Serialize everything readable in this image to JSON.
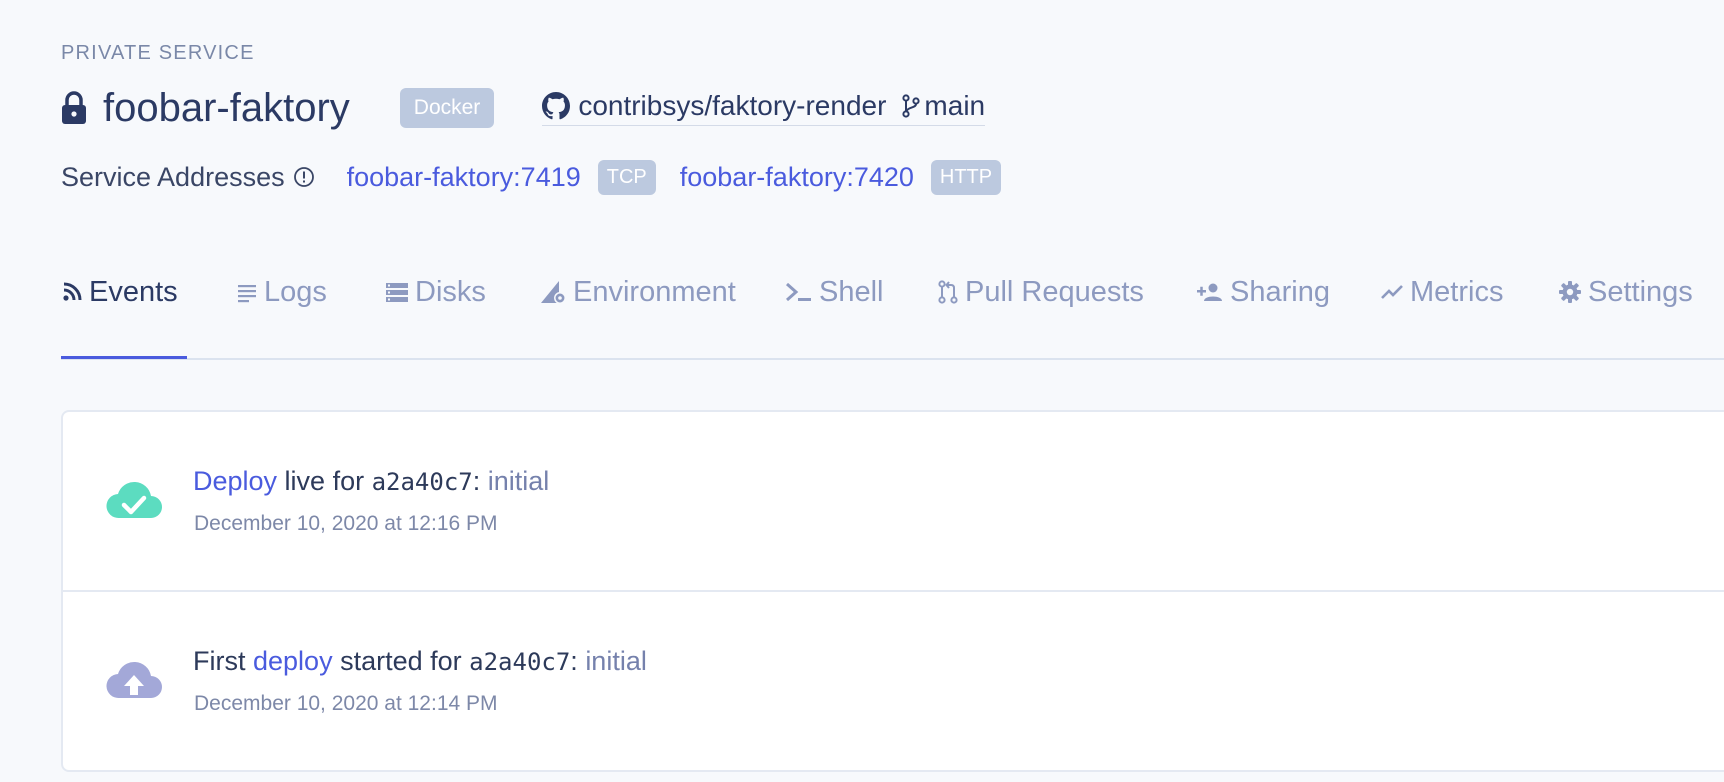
{
  "header": {
    "eyebrow": "PRIVATE SERVICE",
    "title": "foobar-faktory",
    "runtime_badge": "Docker",
    "repo": "contribsys/faktory-render",
    "branch": "main"
  },
  "addresses": {
    "label": "Service Addresses",
    "items": [
      {
        "address": "foobar-faktory:7419",
        "protocol": "TCP"
      },
      {
        "address": "foobar-faktory:7420",
        "protocol": "HTTP"
      }
    ]
  },
  "tabs": [
    {
      "label": "Events",
      "icon": "rss-icon",
      "active": true
    },
    {
      "label": "Logs",
      "icon": "logs-icon"
    },
    {
      "label": "Disks",
      "icon": "disks-icon"
    },
    {
      "label": "Environment",
      "icon": "environment-icon"
    },
    {
      "label": "Shell",
      "icon": "shell-icon"
    },
    {
      "label": "Pull Requests",
      "icon": "pull-request-icon"
    },
    {
      "label": "Sharing",
      "icon": "add-user-icon"
    },
    {
      "label": "Metrics",
      "icon": "metrics-icon"
    },
    {
      "label": "Settings",
      "icon": "gear-icon"
    }
  ],
  "events": [
    {
      "icon": "cloud-check-icon",
      "prefix": "",
      "link": "Deploy",
      "middle": " live for ",
      "sha": "a2a40c7",
      "sep": ": ",
      "message": "initial",
      "date": "December 10, 2020 at 12:16 PM"
    },
    {
      "icon": "cloud-upload-icon",
      "prefix": "First ",
      "link": "deploy",
      "middle": " started for ",
      "sha": "a2a40c7",
      "sep": ": ",
      "message": "initial",
      "date": "December 10, 2020 at 12:14 PM"
    }
  ],
  "colors": {
    "accent": "#4a5bde",
    "success": "#5cdcc0",
    "pending": "#a3a8d8",
    "badge": "#bcc9df"
  }
}
